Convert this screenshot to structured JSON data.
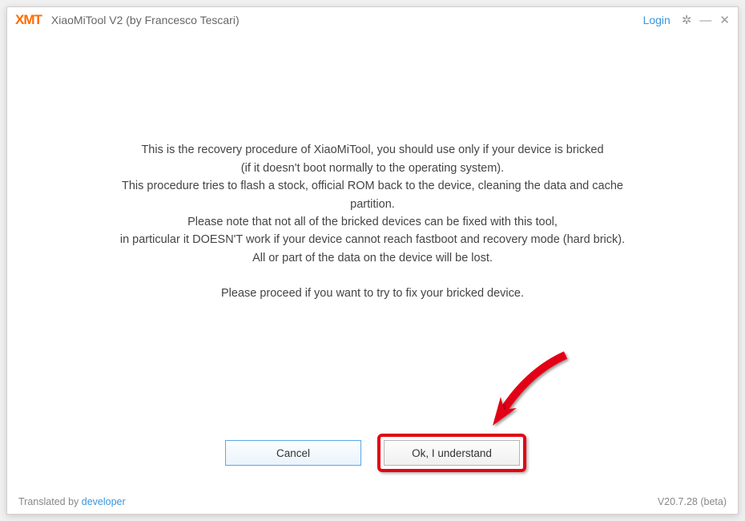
{
  "header": {
    "logo": "XMT",
    "title": "XiaoMiTool V2 (by Francesco Tescari)",
    "login_label": "Login"
  },
  "message": {
    "line1": "This is the recovery procedure of XiaoMiTool, you should use only if your device is bricked",
    "line2": "(if it doesn't boot normally to the operating system).",
    "line3": "This procedure tries to flash a stock, official ROM back to the device, cleaning the data and cache",
    "line4": "partition.",
    "line5": "Please note that not all of the bricked devices can be fixed with this tool,",
    "line6": "in particular it DOESN'T work if your device cannot reach fastboot and recovery mode (hard brick).",
    "line7": "All or part of the data on the device will be lost.",
    "line8": "Please proceed if you want to try to fix your bricked device."
  },
  "buttons": {
    "cancel": "Cancel",
    "ok": "Ok, I understand"
  },
  "footer": {
    "translated_prefix": "Translated by ",
    "translated_link": "developer",
    "version": "V20.7.28 (beta)"
  },
  "annotation": {
    "arrow_color": "#e30613",
    "highlight_color": "#e30613"
  }
}
